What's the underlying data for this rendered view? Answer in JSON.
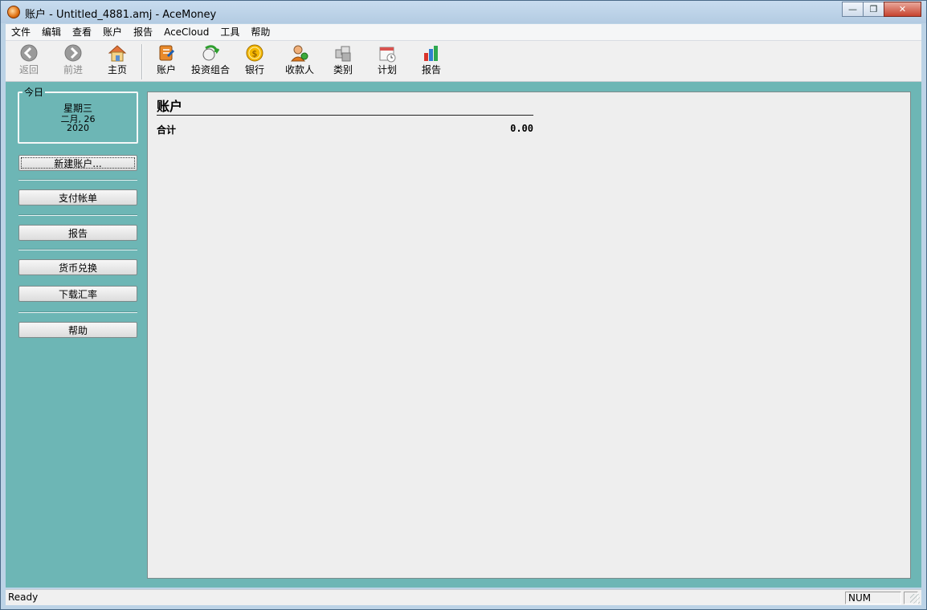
{
  "window": {
    "title": "账户 - Untitled_4881.amj - AceMoney",
    "minimize_glyph": "—",
    "maximize_glyph": "❐",
    "close_glyph": "✕"
  },
  "menu": [
    "文件",
    "编辑",
    "查看",
    "账户",
    "报告",
    "AceCloud",
    "工具",
    "帮助"
  ],
  "toolbar": {
    "back": "返回",
    "forward": "前进",
    "home": "主页",
    "accounts": "账户",
    "portfolio": "投资组合",
    "bank": "银行",
    "payees": "收款人",
    "categories": "类别",
    "schedule": "计划",
    "reports": "报告"
  },
  "sidebar": {
    "today_label": "今日",
    "weekday": "星期三",
    "month_day": "二月, 26",
    "year": "2020",
    "buttons": {
      "new_account": "新建账户...",
      "pay_bills": "支付帐单",
      "reports": "报告",
      "currency_exchange": "货币兑换",
      "download_rates": "下载汇率",
      "help": "帮助"
    }
  },
  "main": {
    "title": "账户",
    "total_label": "合计",
    "total_value": "0.00"
  },
  "status": {
    "text": "Ready",
    "num": "NUM"
  },
  "colors": {
    "client_bg": "#6db6b5",
    "panel_bg": "#eeeeee"
  }
}
